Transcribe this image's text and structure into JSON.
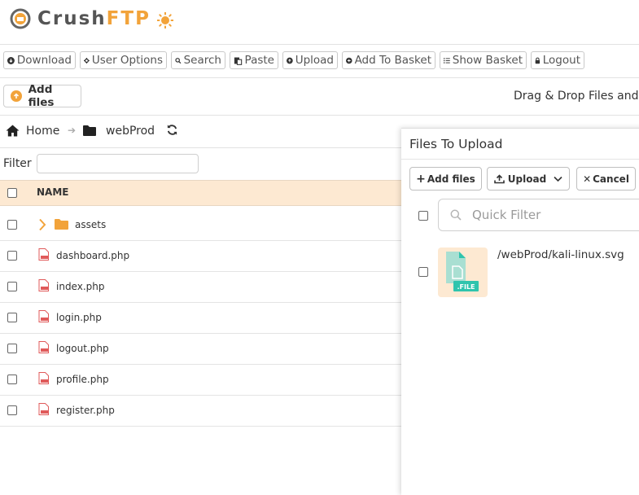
{
  "brand": {
    "part1": "Crush",
    "part2": "FTP"
  },
  "toolbar": [
    {
      "id": "download",
      "label": "Download",
      "icon": "download-icon"
    },
    {
      "id": "user-options",
      "label": "User Options",
      "icon": "gear-icon"
    },
    {
      "id": "search",
      "label": "Search",
      "icon": "search-icon"
    },
    {
      "id": "paste",
      "label": "Paste",
      "icon": "paste-icon"
    },
    {
      "id": "upload",
      "label": "Upload",
      "icon": "upload-icon"
    },
    {
      "id": "add-to-basket",
      "label": "Add To Basket",
      "icon": "plus-circle-icon"
    },
    {
      "id": "show-basket",
      "label": "Show Basket",
      "icon": "list-icon"
    },
    {
      "id": "logout",
      "label": "Logout",
      "icon": "lock-icon"
    }
  ],
  "add_files_label": "Add files",
  "drag_drop_text": "Drag & Drop Files and Fo",
  "breadcrumb": {
    "home": "Home",
    "folder": "webProd"
  },
  "filter": {
    "label": "Filter",
    "value": ""
  },
  "table": {
    "header_name": "NAME",
    "rows": [
      {
        "name": "assets",
        "type": "folder"
      },
      {
        "name": "dashboard.php",
        "type": "file"
      },
      {
        "name": "index.php",
        "type": "file"
      },
      {
        "name": "login.php",
        "type": "file"
      },
      {
        "name": "logout.php",
        "type": "file"
      },
      {
        "name": "profile.php",
        "type": "file"
      },
      {
        "name": "register.php",
        "type": "file"
      }
    ]
  },
  "upload_panel": {
    "title": "Files To Upload",
    "add_files": "Add files",
    "upload": "Upload",
    "cancel": "Cancel",
    "quick_filter_placeholder": "Quick Filter",
    "files": [
      {
        "path": "/webProd/kali-linux.svg",
        "badge": ".FILE"
      }
    ]
  },
  "colors": {
    "accent": "#f2a33a",
    "header_row": "#fde9d2",
    "file_icon": "#e05a5a",
    "file_thumb": "#2fc4ad"
  }
}
